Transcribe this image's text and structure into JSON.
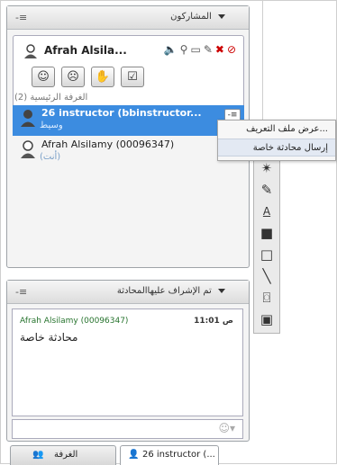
{
  "participants_panel": {
    "title": "المشاركون",
    "menu_icon": "-≡",
    "me": {
      "name": "Afrah Alsila...",
      "status_icons": [
        "speaker-icon",
        "search-person-icon",
        "chat-bubble-icon",
        "pencil-icon",
        "mic-off-icon",
        "clock-off-icon"
      ]
    },
    "toolbar": [
      {
        "icon": "☺",
        "name": "emotion-button"
      },
      {
        "icon": "☹",
        "name": "status-button"
      },
      {
        "icon": "✋",
        "name": "raise-hand-button"
      },
      {
        "icon": "☑",
        "name": "check-button"
      }
    ],
    "room_label": "(2) الغرفة الرئيسية",
    "participants": [
      {
        "name": "26 instructor (bbinstructor...",
        "role": "وسيط",
        "selected": true
      },
      {
        "name": "Afrah Alsilamy (00096347)",
        "role": "(أنت)",
        "selected": false
      }
    ]
  },
  "context_menu": {
    "items": [
      "عرض ملف التعريف...",
      "إرسال محادثة خاصة"
    ]
  },
  "side_tools": {
    "tools": [
      "sparkle-tool-icon",
      "eraser-tool-icon",
      "text-tool-icon",
      "fill-rect-tool-icon",
      "rect-tool-icon",
      "line-tool-icon",
      "camera-tool-icon",
      "image-tool-icon"
    ]
  },
  "chat_panel": {
    "title": "تم الإشراف عليهاالمحادثة",
    "menu_icon": "-≡",
    "message": {
      "author": "Afrah Alsilamy (00096347)",
      "time": "11:01 ص",
      "text": "محادثة خاصة"
    },
    "smiley": "☺▾"
  },
  "tabs": [
    {
      "label": "الغرفة"
    },
    {
      "label": "26 instructor (..."
    }
  ]
}
